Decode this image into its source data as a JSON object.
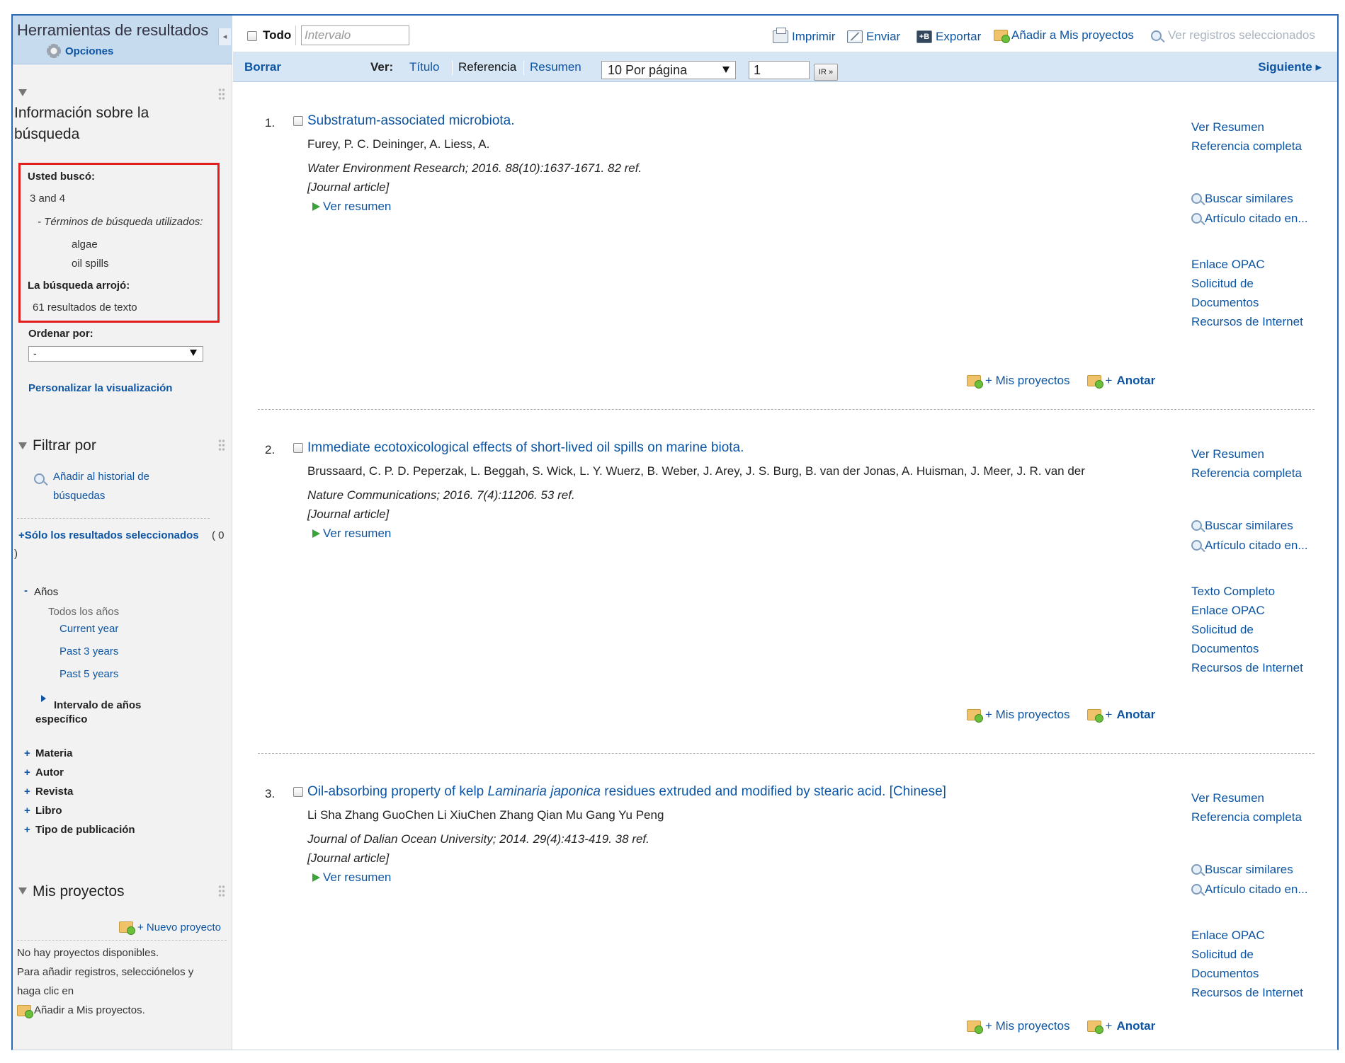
{
  "sidebar": {
    "title": "Herramientas de resultados",
    "options_label": "Opciones",
    "search_info": {
      "title_line1": "Información sobre la",
      "title_line2": "búsqueda",
      "searched_label": "Usted buscó:",
      "query": "3 and 4",
      "terms_label": "- Términos de búsqueda utilizados:",
      "terms": [
        "algae",
        "oil spills"
      ],
      "result_label": "La búsqueda arrojó:",
      "result_value": "61 resultados de texto"
    },
    "sort": {
      "label": "Ordenar por:",
      "selected": "-"
    },
    "customize_label": "Personalizar la visualización",
    "filter": {
      "title": "Filtrar por",
      "add_history_line1": "Añadir al historial de",
      "add_history_line2": "búsquedas",
      "selected_only": "+Sólo los resultados seleccionados",
      "selected_count": "( 0",
      "selected_close": ")",
      "years": {
        "toggle": "-",
        "label": "Años",
        "all": "Todos los años",
        "options": [
          "Current year",
          "Past 3 years",
          "Past 5 years"
        ],
        "range_line1": "Intervalo de años",
        "range_line2": "específico"
      },
      "facets": [
        {
          "sign": "+",
          "label": "Materia"
        },
        {
          "sign": "+",
          "label": "Autor"
        },
        {
          "sign": "+",
          "label": "Revista"
        },
        {
          "sign": "+",
          "label": "Libro"
        },
        {
          "sign": "+",
          "label": "Tipo de publicación"
        }
      ]
    },
    "projects": {
      "title": "Mis proyectos",
      "new_project": "+ Nuevo proyecto",
      "empty": "No hay proyectos disponibles.",
      "hint_line1": "Para añadir registros, selecciónelos y",
      "hint_line2": "haga clic en",
      "hint_line3": "Añadir a Mis proyectos."
    }
  },
  "toolbar": {
    "select_all": "Todo",
    "range_placeholder": "Intervalo",
    "print": "Imprimir",
    "send": "Enviar",
    "export": "Exportar",
    "add_projects": "Añadir a Mis proyectos",
    "view_selected": "Ver registros seleccionados",
    "export_icon_text": "+B"
  },
  "viewbar": {
    "clear": "Borrar",
    "view_label": "Ver:",
    "modes": [
      "Título",
      "Referencia",
      "Resumen"
    ],
    "active_mode": "Referencia",
    "per_page": "10 Por página",
    "page_value": "1",
    "go": "IR »",
    "next": "Siguiente ▸"
  },
  "results": [
    {
      "num": "1.",
      "title": "Substratum-associated microbiota.",
      "title_parts": [
        "Substratum-associated microbiota."
      ],
      "authors": "Furey, P. C. Deininger, A. Liess, A.",
      "source": "Water Environment Research; 2016. 88(10):1637-1671. 82 ref.",
      "type": "[Journal article]",
      "abstract_link": "Ver resumen",
      "links_top": [
        "Ver Resumen",
        "Referencia completa"
      ],
      "links_search": [
        "Buscar similares",
        "Artículo citado en..."
      ],
      "links_bottom": [
        "Enlace OPAC",
        "Solicitud de",
        "Documentos",
        "Recursos de Internet"
      ],
      "my_projects": "+ Mis proyectos",
      "annotate_plus": "+",
      "annotate": "Anotar"
    },
    {
      "num": "2.",
      "title": "Immediate ecotoxicological effects of short-lived oil spills on marine biota.",
      "authors": "Brussaard, C. P. D. Peperzak, L. Beggah, S. Wick, L. Y. Wuerz, B. Weber, J. Arey, J. S. Burg, B. van der Jonas, A. Huisman, J. Meer, J. R. van der",
      "source": "Nature Communications; 2016. 7(4):11206. 53 ref.",
      "type": "[Journal article]",
      "abstract_link": "Ver resumen",
      "links_top": [
        "Ver Resumen",
        "Referencia completa"
      ],
      "links_search": [
        "Buscar similares",
        "Artículo citado en..."
      ],
      "links_bottom": [
        "Texto Completo",
        "Enlace OPAC",
        "Solicitud de",
        "Documentos",
        "Recursos de Internet"
      ],
      "my_projects": "+ Mis proyectos",
      "annotate_plus": "+",
      "annotate": "Anotar"
    },
    {
      "num": "3.",
      "title_a": "Oil-absorbing property of kelp ",
      "title_b": "Laminaria japonica",
      "title_c": " residues extruded and modified by stearic acid. [Chinese]",
      "authors": "Li Sha Zhang GuoChen Li XiuChen Zhang Qian Mu Gang Yu Peng",
      "source": "Journal of Dalian Ocean University; 2014. 29(4):413-419. 38 ref.",
      "type": "[Journal article]",
      "abstract_link": "Ver resumen",
      "links_top": [
        "Ver Resumen",
        "Referencia completa"
      ],
      "links_search": [
        "Buscar similares",
        "Artículo citado en..."
      ],
      "links_bottom": [
        "Enlace OPAC",
        "Solicitud de",
        "Documentos",
        "Recursos de Internet"
      ],
      "my_projects": "+ Mis proyectos",
      "annotate_plus": "+",
      "annotate": "Anotar"
    }
  ],
  "colors": {
    "link": "#0d55a3",
    "highlight_box": "#e21d1d",
    "header_bg": "#c7dbee",
    "bar_bg": "#d6e6f5"
  }
}
